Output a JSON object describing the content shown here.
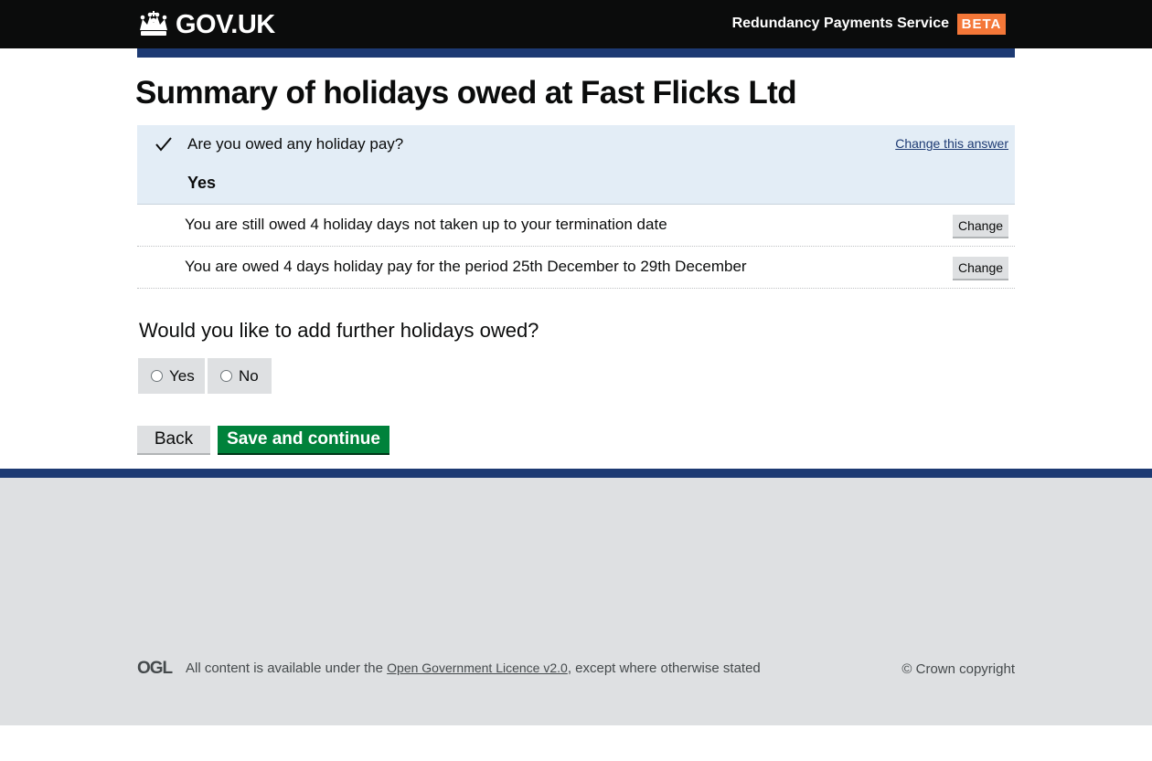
{
  "header": {
    "logo_text": "GOV.UK",
    "service_name": "Redundancy Payments Service",
    "phase_tag": "BETA"
  },
  "main": {
    "title": "Summary of holidays owed at Fast Flicks Ltd",
    "summary": {
      "question": "Are you owed any holiday pay?",
      "answer": "Yes",
      "change_link": "Change this answer"
    },
    "items": [
      {
        "text": "You are still owed 4 holiday days not taken up to your termination date",
        "button": "Change"
      },
      {
        "text": "You are owed 4 days holiday pay for the period 25th December to 29th December",
        "button": "Change"
      }
    ],
    "further_question": "Would you like to add further holidays owed?",
    "radio_yes": "Yes",
    "radio_no": "No",
    "back_label": "Back",
    "save_label": "Save and continue"
  },
  "footer": {
    "ogl": "OGL",
    "licence_prefix": "All content is available under the ",
    "licence_link": "Open Government Licence v2.0",
    "licence_suffix": ", except where otherwise stated",
    "copyright": "© Crown copyright"
  },
  "colors": {
    "header_bg": "#0b0c0c",
    "accent_blue": "#1d3a73",
    "beta_tag": "#f47738",
    "save_button": "#00823b",
    "summary_bg": "#e3edf6"
  },
  "icons": [
    "crown-icon",
    "check-icon"
  ]
}
